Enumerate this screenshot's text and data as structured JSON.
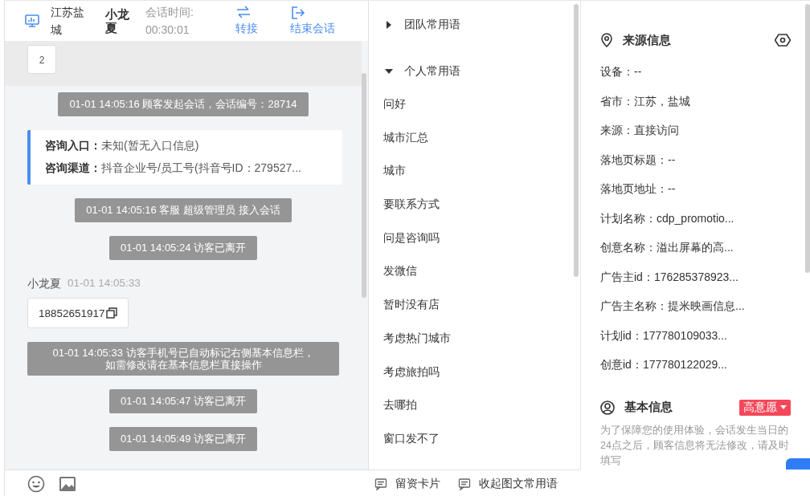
{
  "session_header": {
    "location": "江苏盐城",
    "visitor": "小龙夏",
    "timer_label": "会话时间:",
    "timer": "00:30:01",
    "actions": [
      {
        "kind": "transfer",
        "label": "转接"
      },
      {
        "kind": "end",
        "label": "结束会话"
      }
    ]
  },
  "previous_message": "2",
  "messages": [
    {
      "kind": "system",
      "text": "01-01 14:05:16 顾客发起会话，会话编号：28714"
    },
    {
      "kind": "info",
      "lines": [
        {
          "label": "咨询入口：",
          "value": "未知(暂无入口信息)"
        },
        {
          "label": "咨询渠道：",
          "value": "抖音企业号/员工号(抖音号ID：279527..."
        }
      ]
    },
    {
      "kind": "system",
      "text": "01-01 14:05:16 客服 超级管理员 接入会话"
    },
    {
      "kind": "system",
      "text": "01-01 14:05:24 访客已离开"
    },
    {
      "kind": "visitor",
      "sender": "小龙夏",
      "time": "01-01 14:05:33",
      "text": "18852651917"
    },
    {
      "kind": "system_block",
      "text": "01-01 14:05:33 访客手机号已自动标记右侧基本信息栏，如需修改请在基本信息栏直接操作"
    },
    {
      "kind": "system",
      "text": "01-01 14:05:47 访客已离开"
    },
    {
      "kind": "system",
      "text": "01-01 14:05:49 访客已离开"
    }
  ],
  "composer_tools": [
    {
      "kind": "emoji"
    },
    {
      "kind": "image"
    }
  ],
  "composer_actions": [
    {
      "label": "留资卡片"
    },
    {
      "label": "收起图文常用语"
    }
  ],
  "phrase_groups": [
    {
      "title": "团队常用语",
      "expanded": false
    },
    {
      "title": "个人常用语",
      "expanded": true,
      "items": [
        "问好",
        "城市汇总",
        "城市",
        "要联系方式",
        "问是咨询吗",
        "发微信",
        "暂时没有店",
        "考虑热门城市",
        "考虑旅拍吗",
        "去哪拍",
        "窗口发不了"
      ]
    }
  ],
  "source_info": {
    "title": "来源信息",
    "fields": [
      "设备：--",
      "省市：江苏，盐城",
      "来源：直接访问",
      "落地页标题：--",
      "落地页地址：--",
      "计划名称：cdp_promotio...",
      "创意名称：溢出屏幕的高...",
      "广告主id：176285378923...",
      "广告主名称：提米映画信息...",
      "计划id：177780109033...",
      "创意id：177780122029..."
    ]
  },
  "basic_info": {
    "title": "基本信息",
    "tag": "高意愿",
    "notice": "为了保障您的使用体验，会话发生当日的24点之后，顾客信息将无法修改，请及时填写"
  }
}
